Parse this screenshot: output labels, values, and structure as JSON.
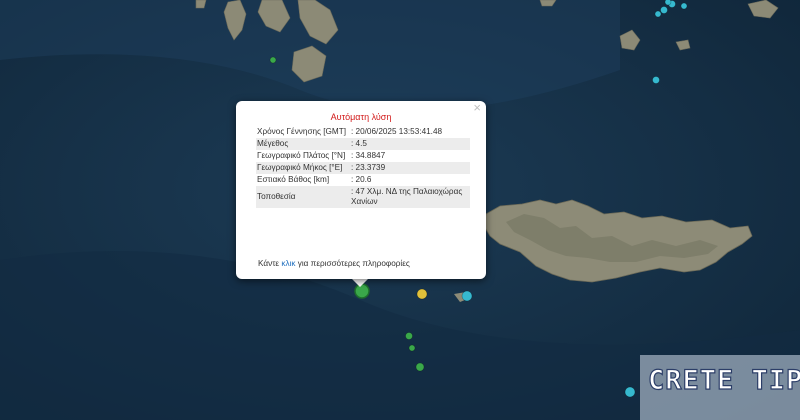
{
  "map": {
    "colors": {
      "sea": "#17324a",
      "land": "#8b8a78",
      "cyan_marker": "#36b9cf",
      "green_marker": "#3aa84a",
      "yellow_marker": "#e2c13a"
    }
  },
  "popup": {
    "title": "Αυτόματη λύση",
    "close_glyph": "×",
    "rows": [
      {
        "label": "Χρόνος Γέννησης [GMT]",
        "value": ": 20/06/2025 13:53:41.48"
      },
      {
        "label": "Μέγεθος",
        "value": ": 4.5"
      },
      {
        "label": "Γεωγραφικό Πλάτος [°N]",
        "value": ": 34.8847"
      },
      {
        "label": "Γεωγραφικό Μήκος [°E]",
        "value": ": 23.3739"
      },
      {
        "label": "Εστιακό Βάθος [km]",
        "value": ": 20.6"
      },
      {
        "label": "Τοποθεσία",
        "value": ": 47 Χλμ. ΝΔ της Παλαιοχώρας Χανίων"
      }
    ],
    "footer_before": "Κάντε ",
    "footer_link": "κλικ",
    "footer_after": " για περισσότερες πληροφορίες"
  },
  "watermark": {
    "text": "CRETE TIP"
  },
  "markers": [
    {
      "color": "green",
      "type": "selected-event",
      "magnitude": 4.5
    },
    {
      "color": "yellow"
    },
    {
      "color": "cyan"
    },
    {
      "color": "cyan"
    },
    {
      "color": "cyan"
    },
    {
      "color": "cyan"
    },
    {
      "color": "cyan"
    },
    {
      "color": "cyan"
    },
    {
      "color": "cyan"
    },
    {
      "color": "cyan"
    },
    {
      "color": "green"
    },
    {
      "color": "green"
    },
    {
      "color": "green"
    },
    {
      "color": "green"
    }
  ]
}
